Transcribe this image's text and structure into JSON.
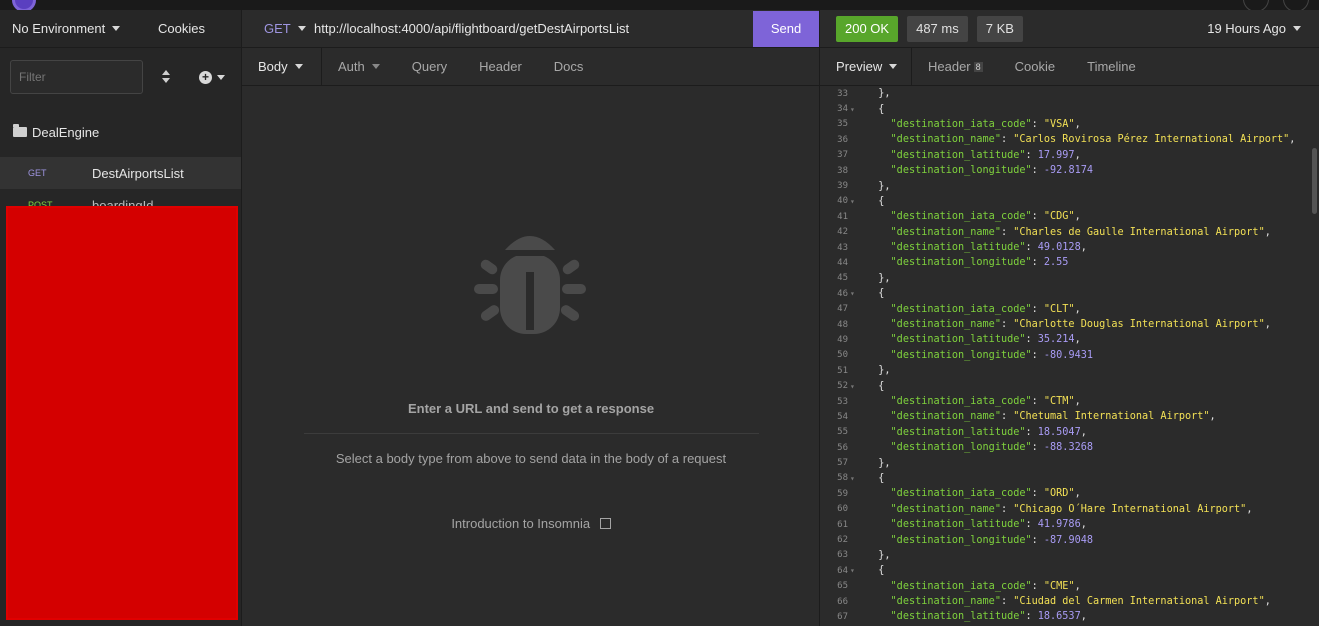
{
  "sidebar": {
    "environment": "No Environment",
    "cookies": "Cookies",
    "filter_placeholder": "Filter",
    "workspace": "DealEngine",
    "requests": [
      {
        "method": "GET",
        "name": "DestAirportsList"
      },
      {
        "method": "POST",
        "name": "boardingId"
      }
    ]
  },
  "request": {
    "method": "GET",
    "url": "http://localhost:4000/api/flightboard/getDestAirportsList",
    "send_label": "Send",
    "tabs": [
      "Body",
      "Auth",
      "Query",
      "Header",
      "Docs"
    ],
    "empty_title": "Enter a URL and send to get a response",
    "empty_subtitle": "Select a body type from above to send data in the body of a request",
    "intro_link": "Introduction to Insomnia"
  },
  "response": {
    "status": "200 OK",
    "time": "487 ms",
    "size": "7 KB",
    "ago": "19 Hours Ago",
    "tabs": {
      "preview": "Preview",
      "header": "Header",
      "header_count": "8",
      "cookie": "Cookie",
      "timeline": "Timeline"
    },
    "lines": [
      {
        "n": "33",
        "t": "  },"
      },
      {
        "n": "34",
        "t": "  {",
        "fold": true
      },
      {
        "n": "35",
        "k": "destination_iata_code",
        "s": "VSA"
      },
      {
        "n": "36",
        "k": "destination_name",
        "s": "Carlos Rovirosa Pérez International Airport"
      },
      {
        "n": "37",
        "k": "destination_latitude",
        "v": "17.997"
      },
      {
        "n": "38",
        "k": "destination_longitude",
        "v": "-92.8174",
        "last": true
      },
      {
        "n": "39",
        "t": "  },"
      },
      {
        "n": "40",
        "t": "  {",
        "fold": true
      },
      {
        "n": "41",
        "k": "destination_iata_code",
        "s": "CDG"
      },
      {
        "n": "42",
        "k": "destination_name",
        "s": "Charles de Gaulle International Airport"
      },
      {
        "n": "43",
        "k": "destination_latitude",
        "v": "49.0128"
      },
      {
        "n": "44",
        "k": "destination_longitude",
        "v": "2.55",
        "last": true
      },
      {
        "n": "45",
        "t": "  },"
      },
      {
        "n": "46",
        "t": "  {",
        "fold": true
      },
      {
        "n": "47",
        "k": "destination_iata_code",
        "s": "CLT"
      },
      {
        "n": "48",
        "k": "destination_name",
        "s": "Charlotte Douglas International Airport"
      },
      {
        "n": "49",
        "k": "destination_latitude",
        "v": "35.214"
      },
      {
        "n": "50",
        "k": "destination_longitude",
        "v": "-80.9431",
        "last": true
      },
      {
        "n": "51",
        "t": "  },"
      },
      {
        "n": "52",
        "t": "  {",
        "fold": true
      },
      {
        "n": "53",
        "k": "destination_iata_code",
        "s": "CTM"
      },
      {
        "n": "54",
        "k": "destination_name",
        "s": "Chetumal International Airport"
      },
      {
        "n": "55",
        "k": "destination_latitude",
        "v": "18.5047"
      },
      {
        "n": "56",
        "k": "destination_longitude",
        "v": "-88.3268",
        "last": true
      },
      {
        "n": "57",
        "t": "  },"
      },
      {
        "n": "58",
        "t": "  {",
        "fold": true
      },
      {
        "n": "59",
        "k": "destination_iata_code",
        "s": "ORD"
      },
      {
        "n": "60",
        "k": "destination_name",
        "s": "Chicago O´Hare International Airport"
      },
      {
        "n": "61",
        "k": "destination_latitude",
        "v": "41.9786"
      },
      {
        "n": "62",
        "k": "destination_longitude",
        "v": "-87.9048",
        "last": true
      },
      {
        "n": "63",
        "t": "  },"
      },
      {
        "n": "64",
        "t": "  {",
        "fold": true
      },
      {
        "n": "65",
        "k": "destination_iata_code",
        "s": "CME"
      },
      {
        "n": "66",
        "k": "destination_name",
        "s": "Ciudad del Carmen International Airport"
      },
      {
        "n": "67",
        "k": "destination_latitude",
        "v": "18.6537"
      }
    ]
  },
  "colors": {
    "accent": "#7e64d8",
    "success": "#58a62b",
    "json_key": "#7fd23d",
    "json_string": "#f2e055",
    "json_number": "#a99cf5",
    "redacted": "#d40000"
  }
}
